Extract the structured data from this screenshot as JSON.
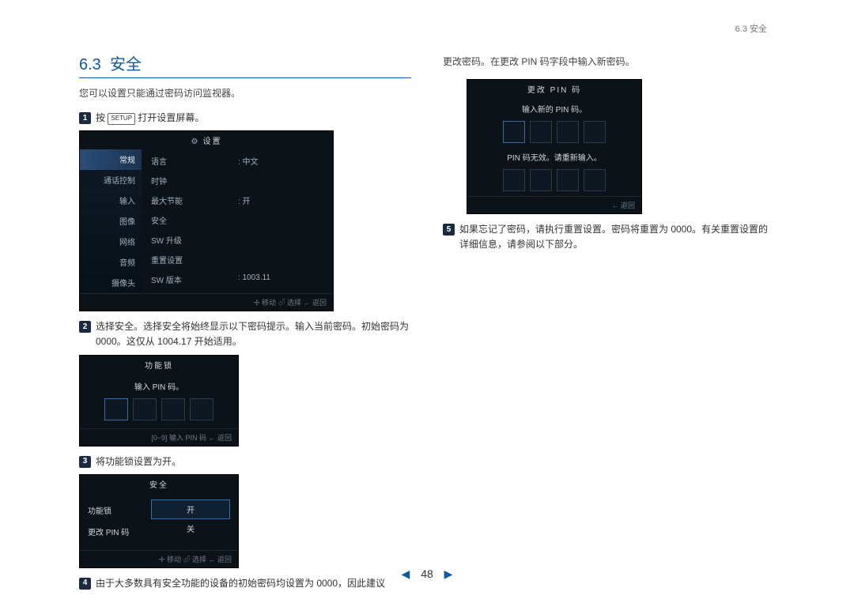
{
  "header": {
    "running": "6.3 安全"
  },
  "section": {
    "number": "6.3",
    "title": "安全"
  },
  "intro": "您可以设置只能通过密码访问监视器。",
  "steps": {
    "s1": {
      "pre": "按",
      "key": "SETUP",
      "post": "打开设置屏幕。"
    },
    "s2": "选择安全。选择安全将始终显示以下密码提示。输入当前密码。初始密码为 0000。这仅从 1004.17 开始适用。",
    "s3": "将功能锁设置为开。",
    "s4": "由于大多数具有安全功能的设备的初始密码均设置为 0000，因此建议",
    "s4b": "更改密码。在更改 PIN 码字段中输入新密码。",
    "s5": "如果忘记了密码，请执行重置设置。密码将重置为 0000。有关重置设置的详细信息，请参阅以下部分。"
  },
  "osd1": {
    "title": "设置",
    "tabs": [
      "常规",
      "通话控制",
      "输入",
      "图像",
      "网络",
      "音频",
      "摄像头"
    ],
    "rows": [
      {
        "k": "语言",
        "v": ": 中文"
      },
      {
        "k": "时钟",
        "v": ""
      },
      {
        "k": "最大节能",
        "v": ": 开"
      },
      {
        "k": "安全",
        "v": ""
      },
      {
        "k": "SW 升级",
        "v": ""
      },
      {
        "k": "重置设置",
        "v": ""
      },
      {
        "k": "SW 版本",
        "v": ": 1003.11"
      }
    ],
    "foot": "✢ 移动    ⏎ 选择    ← 返回"
  },
  "osd2": {
    "title": "功能锁",
    "msg": "输入 PIN 码。",
    "foot": "[0~9] 输入 PIN 码   ← 返回"
  },
  "osd3": {
    "title": "安全",
    "labels": [
      "功能锁",
      "更改 PIN 码"
    ],
    "opts": [
      "开",
      "关"
    ],
    "foot": "✢ 移动   ⏎ 选择   ← 返回"
  },
  "osd4": {
    "title": "更改 PIN 码",
    "msg": "输入新的 PIN 码。",
    "err": "PIN 码无效。请重新输入。",
    "foot": "← 返回"
  },
  "pagenav": {
    "page": "48"
  }
}
